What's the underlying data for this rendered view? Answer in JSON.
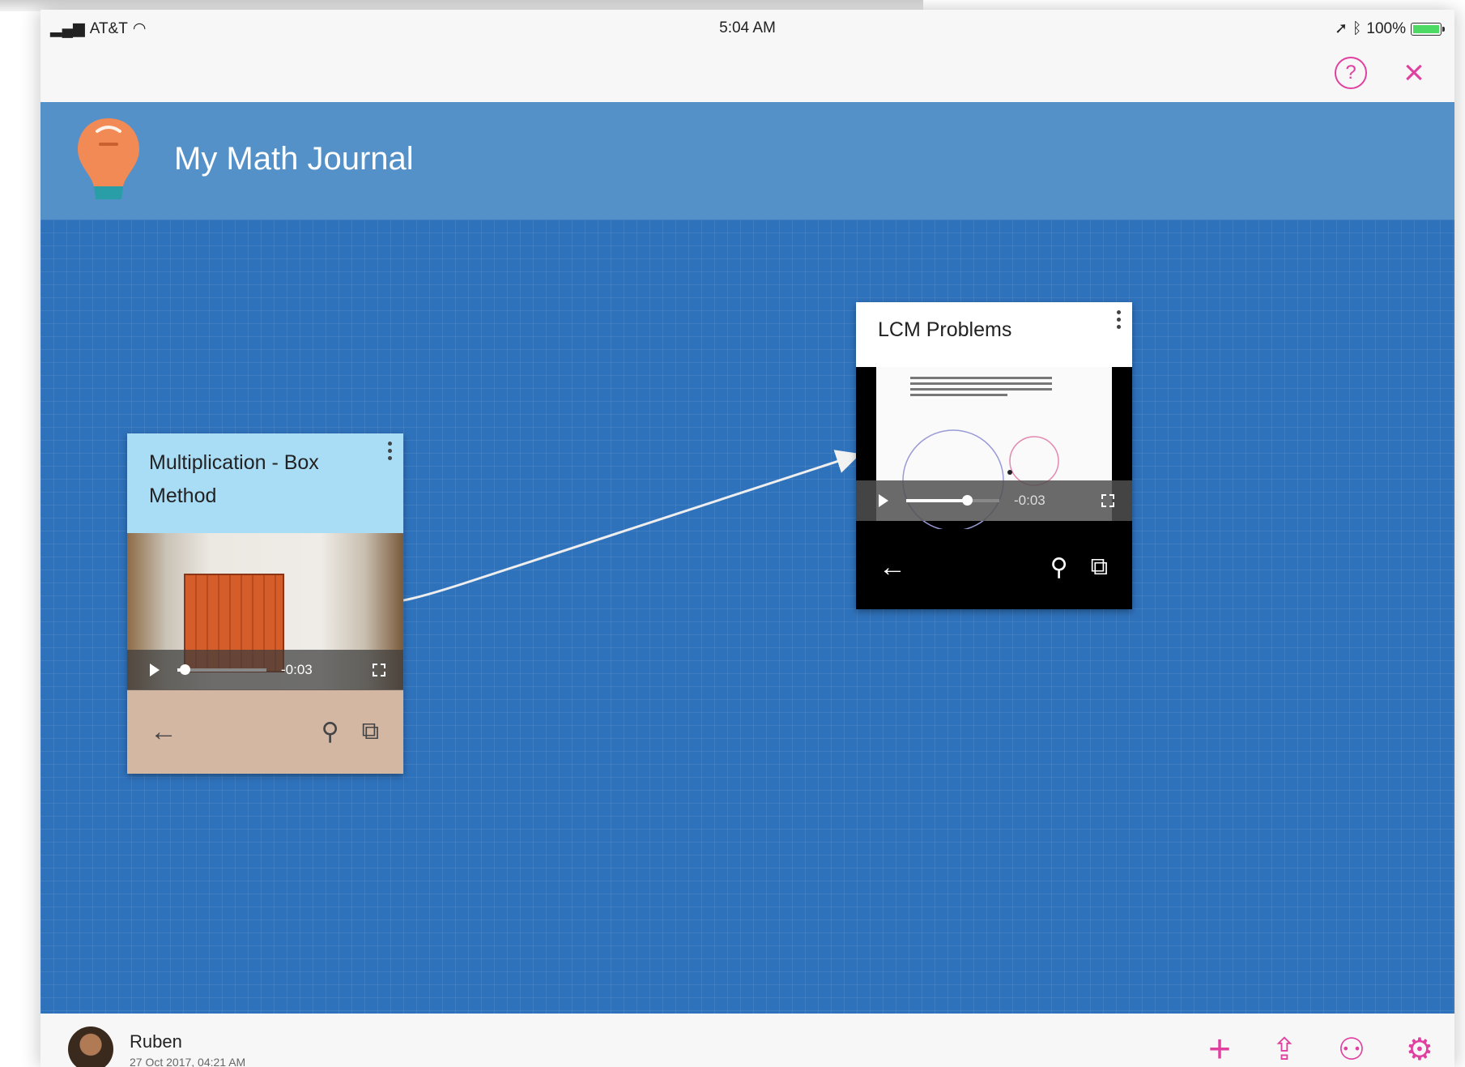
{
  "status_bar": {
    "carrier": "AT&T",
    "time": "5:04 AM",
    "battery": "100%",
    "battery_level": 1.0
  },
  "header": {
    "title": "My Math Journal",
    "accent_color": "#5391c8",
    "brand_color": "#f28a55"
  },
  "canvas": {
    "background_color": "#2f72bc",
    "cards": [
      {
        "title": "Multiplication - Box Method",
        "video_time": "-0:03",
        "progress": 0.08
      },
      {
        "title": "LCM Problems",
        "video_time": "-0:03",
        "progress": 0.65
      }
    ]
  },
  "footer": {
    "user_name": "Ruben",
    "timestamp": "27 Oct 2017, 04:21 AM"
  },
  "icons": {
    "top": [
      "help-icon",
      "close-icon"
    ],
    "card": [
      "more-options-icon",
      "play-icon",
      "fullscreen-icon",
      "back-arrow-icon",
      "zoom-icon",
      "open-external-icon"
    ],
    "bottom": [
      "add-icon",
      "share-icon",
      "collaborators-icon",
      "settings-icon"
    ],
    "accent_icon_color": "#e040a0"
  }
}
